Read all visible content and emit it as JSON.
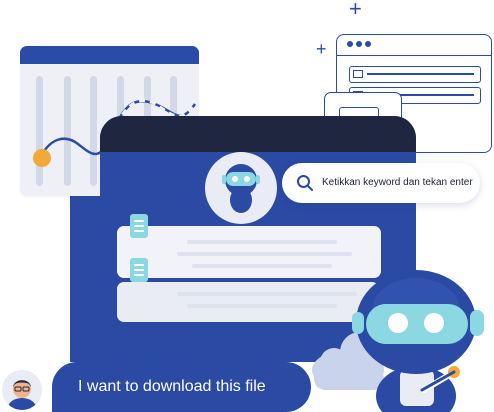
{
  "search": {
    "placeholder": "Ketikkan keyword dan tekan enter"
  },
  "chat": {
    "message": "I want to download this file"
  },
  "icons": {
    "search": "search-icon",
    "robot_small": "robot-avatar-icon",
    "robot_large": "robot-mascot-icon",
    "user": "user-avatar-icon",
    "cloud": "cloud-icon",
    "document": "document-icon",
    "plus": "plus-icon"
  },
  "colors": {
    "primary": "#2a4aa3",
    "titlebar": "#1f2640",
    "accent_cyan": "#8bd8e2",
    "accent_orange": "#f5a83a"
  }
}
